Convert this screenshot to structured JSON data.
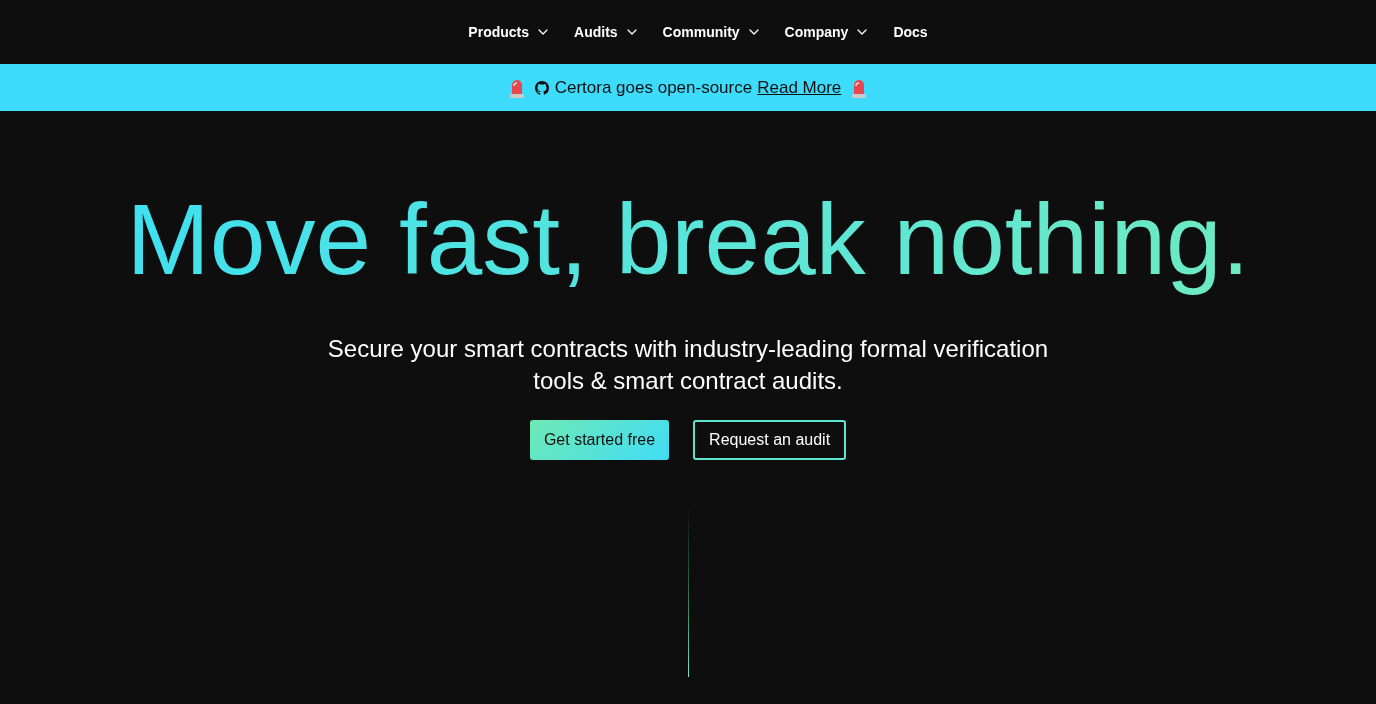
{
  "nav": {
    "items": [
      {
        "label": "Products",
        "dropdown": true
      },
      {
        "label": "Audits",
        "dropdown": true
      },
      {
        "label": "Community",
        "dropdown": true
      },
      {
        "label": "Company",
        "dropdown": true
      },
      {
        "label": "Docs",
        "dropdown": false
      }
    ]
  },
  "banner": {
    "text": "Certora goes open-source",
    "link": "Read More"
  },
  "hero": {
    "headline": "Move fast, break nothing.",
    "subtitle": "Secure your smart contracts with industry-leading formal verification tools & smart contract audits.",
    "buttons": [
      {
        "label": "Get started free",
        "kind": "primary"
      },
      {
        "label": "Request an audit",
        "kind": "outline"
      }
    ]
  }
}
